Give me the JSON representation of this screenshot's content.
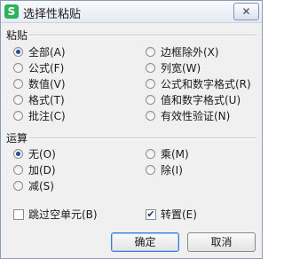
{
  "window": {
    "title": "选择性粘贴",
    "app_icon_glyph": "S",
    "close_glyph": "✕"
  },
  "paste": {
    "label": "粘贴",
    "options": [
      {
        "label": "全部(A)",
        "selected": true
      },
      {
        "label": "公式(F)",
        "selected": false
      },
      {
        "label": "数值(V)",
        "selected": false
      },
      {
        "label": "格式(T)",
        "selected": false
      },
      {
        "label": "批注(C)",
        "selected": false
      },
      {
        "label": "边框除外(X)",
        "selected": false
      },
      {
        "label": "列宽(W)",
        "selected": false
      },
      {
        "label": "公式和数字格式(R)",
        "selected": false
      },
      {
        "label": "值和数字格式(U)",
        "selected": false
      },
      {
        "label": "有效性验证(N)",
        "selected": false
      }
    ]
  },
  "operation": {
    "label": "运算",
    "options": [
      {
        "label": "无(O)",
        "selected": true
      },
      {
        "label": "加(D)",
        "selected": false
      },
      {
        "label": "减(S)",
        "selected": false
      },
      {
        "label": "乘(M)",
        "selected": false
      },
      {
        "label": "除(I)",
        "selected": false
      }
    ]
  },
  "skip_blanks": {
    "label": "跳过空单元(B)",
    "checked": false
  },
  "transpose": {
    "label": "转置(E)",
    "checked": true
  },
  "buttons": {
    "ok": "确定",
    "cancel": "取消"
  },
  "colors": {
    "accent": "#1e4fa0",
    "app_icon": "#2fb35a"
  }
}
